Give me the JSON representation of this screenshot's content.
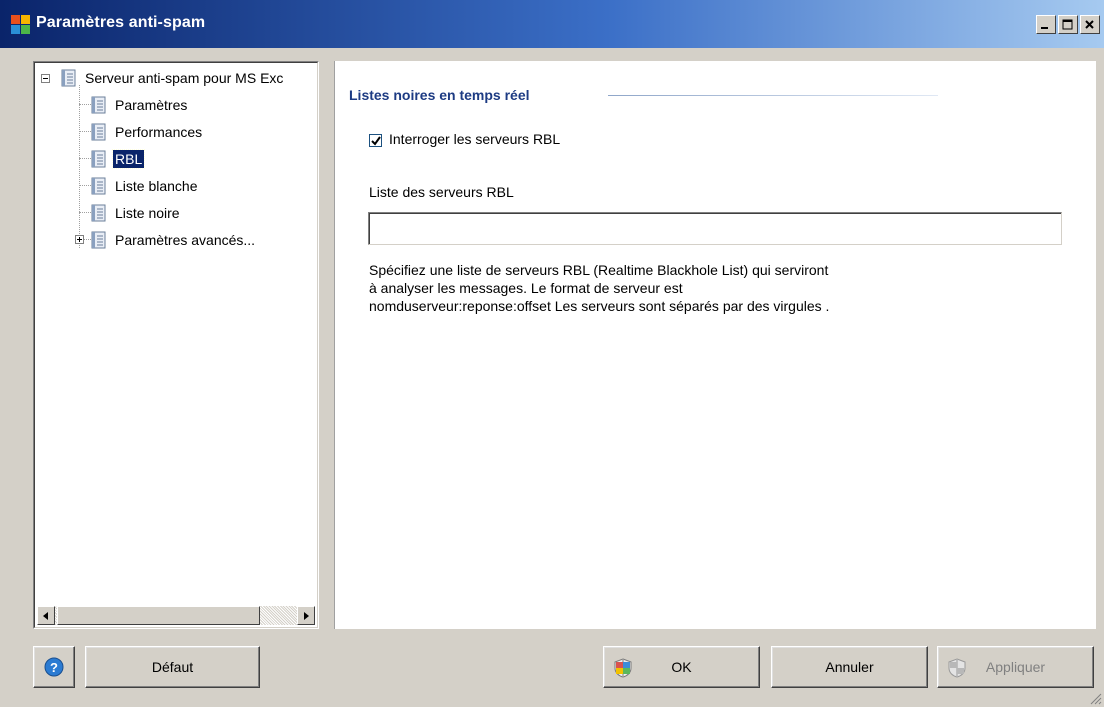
{
  "window": {
    "title": "Paramètres anti-spam"
  },
  "tree": {
    "root": "Serveur anti-spam pour MS Exc",
    "items": [
      {
        "label": "Paramètres"
      },
      {
        "label": "Performances"
      },
      {
        "label": "RBL",
        "selected": true
      },
      {
        "label": "Liste blanche"
      },
      {
        "label": "Liste noire"
      },
      {
        "label": "Paramètres avancés..."
      }
    ]
  },
  "content": {
    "section_title": "Listes noires en temps réel",
    "checkbox_label": "Interroger les serveurs RBL",
    "checkbox_checked": true,
    "field_label": "Liste des serveurs RBL",
    "field_value": "",
    "help_text": "Spécifiez une liste de serveurs RBL (Realtime Blackhole List) qui serviront à analyser les messages. Le format  de serveur est nomduserveur:reponse:offset Les serveurs sont séparés par des virgules ."
  },
  "buttons": {
    "default": "Défaut",
    "ok": "OK",
    "cancel": "Annuler",
    "apply": "Appliquer"
  },
  "icons": {
    "help": "help-icon",
    "shield": "shield-icon",
    "book": "book-icon"
  },
  "colors": {
    "titlebar": "#0a246a",
    "selection": "#0a246a",
    "section_title": "#1d3b83"
  }
}
